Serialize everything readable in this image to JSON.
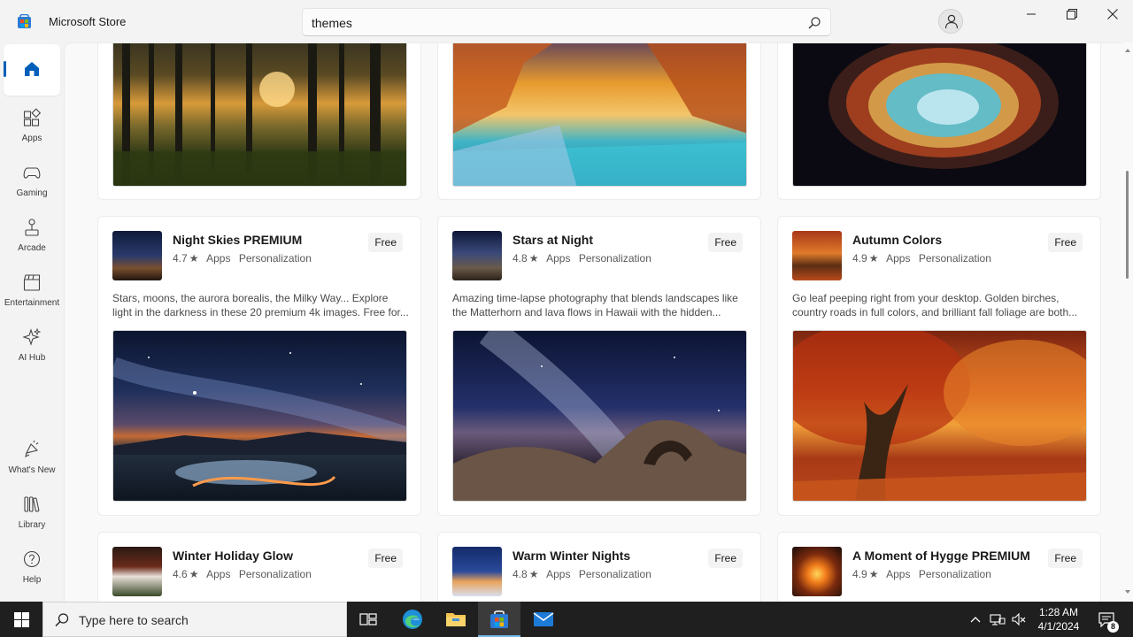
{
  "window": {
    "app_title": "Microsoft Store",
    "search_value": "themes",
    "controls": [
      "minimize",
      "maximize",
      "close"
    ]
  },
  "sidebar": {
    "items": [
      {
        "label": "",
        "icon": "home-icon",
        "active": true
      },
      {
        "label": "Apps",
        "icon": "apps-icon"
      },
      {
        "label": "Gaming",
        "icon": "gaming-icon"
      },
      {
        "label": "Arcade",
        "icon": "arcade-icon"
      },
      {
        "label": "Entertainment",
        "icon": "entertainment-icon"
      },
      {
        "label": "AI Hub",
        "icon": "ai-hub-icon"
      },
      {
        "label": "What's New",
        "icon": "whats-new-icon"
      },
      {
        "label": "Library",
        "icon": "library-icon"
      },
      {
        "label": "Help",
        "icon": "help-icon"
      }
    ]
  },
  "cards": [
    {
      "title": "Night Skies PREMIUM",
      "rating": "4.7",
      "category": "Apps",
      "subcategory": "Personalization",
      "price": "Free",
      "description": "Stars, moons, the aurora borealis, the Milky Way... Explore light in the darkness in these 20 premium 4k images. Free for..."
    },
    {
      "title": "Stars at Night",
      "rating": "4.8",
      "category": "Apps",
      "subcategory": "Personalization",
      "price": "Free",
      "description": "Amazing time-lapse photography that blends landscapes like the Matterhorn and lava flows in Hawaii with the hidden..."
    },
    {
      "title": "Autumn Colors",
      "rating": "4.9",
      "category": "Apps",
      "subcategory": "Personalization",
      "price": "Free",
      "description": "Go leaf peeping right from your desktop. Golden birches, country roads in full colors, and brilliant fall foliage are both..."
    },
    {
      "title": "Winter Holiday Glow",
      "rating": "4.6",
      "category": "Apps",
      "subcategory": "Personalization",
      "price": "Free"
    },
    {
      "title": "Warm Winter Nights",
      "rating": "4.8",
      "category": "Apps",
      "subcategory": "Personalization",
      "price": "Free"
    },
    {
      "title": "A Moment of Hygge PREMIUM",
      "rating": "4.9",
      "category": "Apps",
      "subcategory": "Personalization",
      "price": "Free"
    }
  ],
  "taskbar": {
    "search_placeholder": "Type here to search",
    "time": "1:28 AM",
    "date": "4/1/2024",
    "notification_count": "8"
  },
  "colors": {
    "accent": "#005fb8",
    "taskbar": "#1f1f1f",
    "content_bg": "#f9f9f9"
  }
}
